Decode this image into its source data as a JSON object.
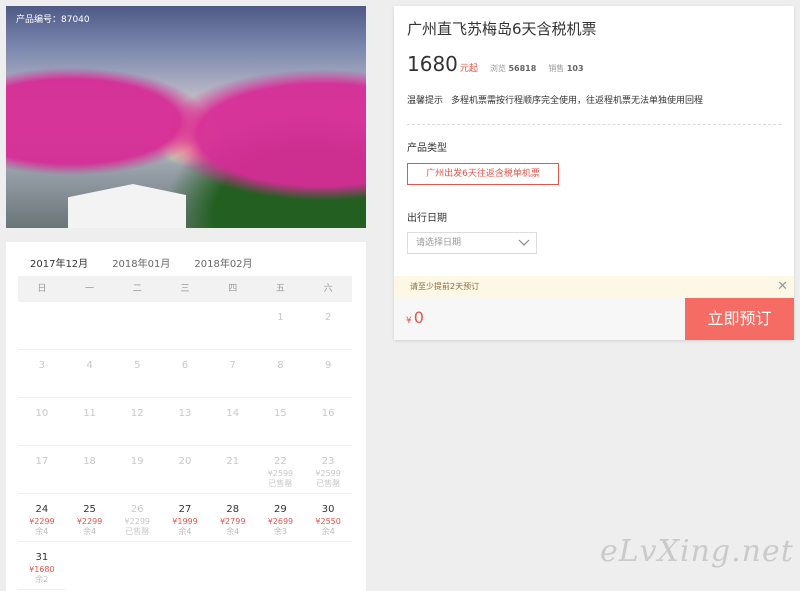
{
  "image": {
    "product_code": "产品编号：87040"
  },
  "calendar": {
    "tabs": [
      "2017年12月",
      "2018年01月",
      "2018年02月"
    ],
    "weekdays": [
      "日",
      "一",
      "二",
      "三",
      "四",
      "五",
      "六"
    ],
    "days": [
      {
        "n": "",
        "p": "",
        "s": "",
        "on": false
      },
      {
        "n": "",
        "p": "",
        "s": "",
        "on": false
      },
      {
        "n": "",
        "p": "",
        "s": "",
        "on": false
      },
      {
        "n": "",
        "p": "",
        "s": "",
        "on": false
      },
      {
        "n": "",
        "p": "",
        "s": "",
        "on": false
      },
      {
        "n": "1",
        "p": "",
        "s": "",
        "on": false
      },
      {
        "n": "2",
        "p": "",
        "s": "",
        "on": false
      },
      {
        "n": "3",
        "p": "",
        "s": "",
        "on": false
      },
      {
        "n": "4",
        "p": "",
        "s": "",
        "on": false
      },
      {
        "n": "5",
        "p": "",
        "s": "",
        "on": false
      },
      {
        "n": "6",
        "p": "",
        "s": "",
        "on": false
      },
      {
        "n": "7",
        "p": "",
        "s": "",
        "on": false
      },
      {
        "n": "8",
        "p": "",
        "s": "",
        "on": false
      },
      {
        "n": "9",
        "p": "",
        "s": "",
        "on": false
      },
      {
        "n": "10",
        "p": "",
        "s": "",
        "on": false
      },
      {
        "n": "11",
        "p": "",
        "s": "",
        "on": false
      },
      {
        "n": "12",
        "p": "",
        "s": "",
        "on": false
      },
      {
        "n": "13",
        "p": "",
        "s": "",
        "on": false
      },
      {
        "n": "14",
        "p": "",
        "s": "",
        "on": false
      },
      {
        "n": "15",
        "p": "",
        "s": "",
        "on": false
      },
      {
        "n": "16",
        "p": "",
        "s": "",
        "on": false
      },
      {
        "n": "17",
        "p": "",
        "s": "",
        "on": false
      },
      {
        "n": "18",
        "p": "",
        "s": "",
        "on": false
      },
      {
        "n": "19",
        "p": "",
        "s": "",
        "on": false
      },
      {
        "n": "20",
        "p": "",
        "s": "",
        "on": false
      },
      {
        "n": "21",
        "p": "",
        "s": "",
        "on": false
      },
      {
        "n": "22",
        "p": "¥2599",
        "s": "已售罄",
        "on": false
      },
      {
        "n": "23",
        "p": "¥2599",
        "s": "已售罄",
        "on": false
      },
      {
        "n": "24",
        "p": "¥2299",
        "s": "余4",
        "on": true
      },
      {
        "n": "25",
        "p": "¥2299",
        "s": "余4",
        "on": true
      },
      {
        "n": "26",
        "p": "¥2299",
        "s": "已售罄",
        "on": false
      },
      {
        "n": "27",
        "p": "¥1999",
        "s": "余4",
        "on": true
      },
      {
        "n": "28",
        "p": "¥2799",
        "s": "余4",
        "on": true
      },
      {
        "n": "29",
        "p": "¥2699",
        "s": "余3",
        "on": true
      },
      {
        "n": "30",
        "p": "¥2550",
        "s": "余4",
        "on": true
      },
      {
        "n": "31",
        "p": "¥1680",
        "s": "余2",
        "on": true
      }
    ]
  },
  "panel": {
    "title": "广州直飞苏梅岛6天含税机票",
    "price": "1680",
    "price_unit": "元起",
    "views_label": "浏览",
    "views": "56818",
    "sales_label": "销售",
    "sales": "103",
    "tip_label": "温馨提示",
    "tip_text": "多程机票需按行程顺序完全使用，往返程机票无法单独使用回程",
    "product_type_label": "产品类型",
    "product_option": "广州出发6天往返含税单机票",
    "date_label": "出行日期",
    "date_placeholder": "请选择日期",
    "warning": "请至少提前2天预订",
    "currency": "¥",
    "total": "0",
    "book_label": "立即预订"
  },
  "watermark": "eLvXing.net",
  "colors": {
    "accent": "#e0584b",
    "book_button": "#f46c63",
    "warning_bg": "#fdf8e6"
  }
}
